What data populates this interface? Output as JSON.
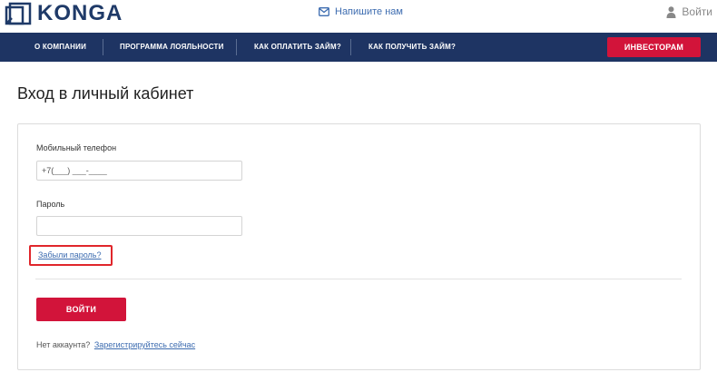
{
  "header": {
    "logo_text": "KONGA",
    "write_us": "Напишите нам",
    "login": "Войти"
  },
  "nav": {
    "items": [
      {
        "label": "О КОМПАНИИ"
      },
      {
        "label": "ПРОГРАММА ЛОЯЛЬНОСТИ"
      },
      {
        "label": "КАК ОПЛАТИТЬ ЗАЙМ?"
      },
      {
        "label": "КАК ПОЛУЧИТЬ ЗАЙМ?"
      }
    ],
    "investors": "ИНВЕСТОРАМ"
  },
  "main": {
    "title": "Вход в личный кабинет",
    "phone": {
      "label": "Мобильный телефон",
      "value": "+7(___) ___-____"
    },
    "password": {
      "label": "Пароль",
      "value": ""
    },
    "forgot": "Забыли пароль?",
    "submit": "ВОЙТИ",
    "no_account": "Нет аккаунта?",
    "register": "Зарегистрируйтесь сейчас"
  },
  "colors": {
    "nav_bg": "#1e3463",
    "accent_red": "#d2143a",
    "link_blue": "#3d6cb0",
    "highlight_border": "#e0262b"
  }
}
